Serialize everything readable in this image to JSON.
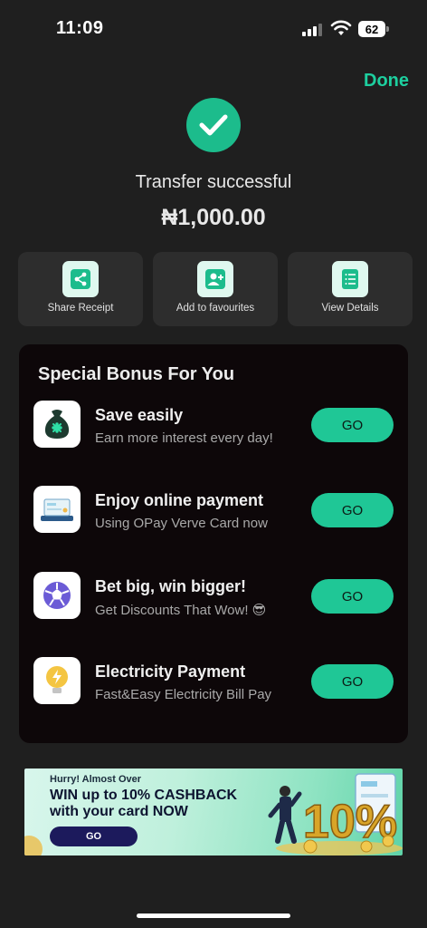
{
  "status_bar": {
    "time": "11:09",
    "battery": "62"
  },
  "header": {
    "done_label": "Done"
  },
  "result": {
    "status": "Transfer successful",
    "amount": "₦1,000.00"
  },
  "actions": [
    {
      "label": "Share Receipt",
      "icon": "share-icon"
    },
    {
      "label": "Add to favourites",
      "icon": "add-user-icon"
    },
    {
      "label": "View Details",
      "icon": "document-icon"
    }
  ],
  "bonus": {
    "title": "Special Bonus For You",
    "items": [
      {
        "name": "Save easily",
        "desc": "Earn more interest every day!",
        "go": "GO",
        "icon": "money-bag-icon"
      },
      {
        "name": "Enjoy online payment",
        "desc": "Using OPay Verve Card now",
        "go": "GO",
        "icon": "card-icon"
      },
      {
        "name": "Bet big, win bigger!",
        "desc": "Get Discounts That Wow! 😎",
        "go": "GO",
        "icon": "soccer-ball-icon"
      },
      {
        "name": "Electricity Payment",
        "desc": "Fast&Easy Electricity Bill Pay",
        "go": "GO",
        "icon": "lightbulb-icon"
      }
    ]
  },
  "promo": {
    "small": "Hurry! Almost Over",
    "headline_1": "WIN up to 10% CASHBACK",
    "headline_2": "with your card NOW",
    "go": "GO",
    "badge": "10%"
  },
  "colors": {
    "accent": "#1fc796",
    "background": "#1f1f1f",
    "panel": "#0d0709"
  }
}
